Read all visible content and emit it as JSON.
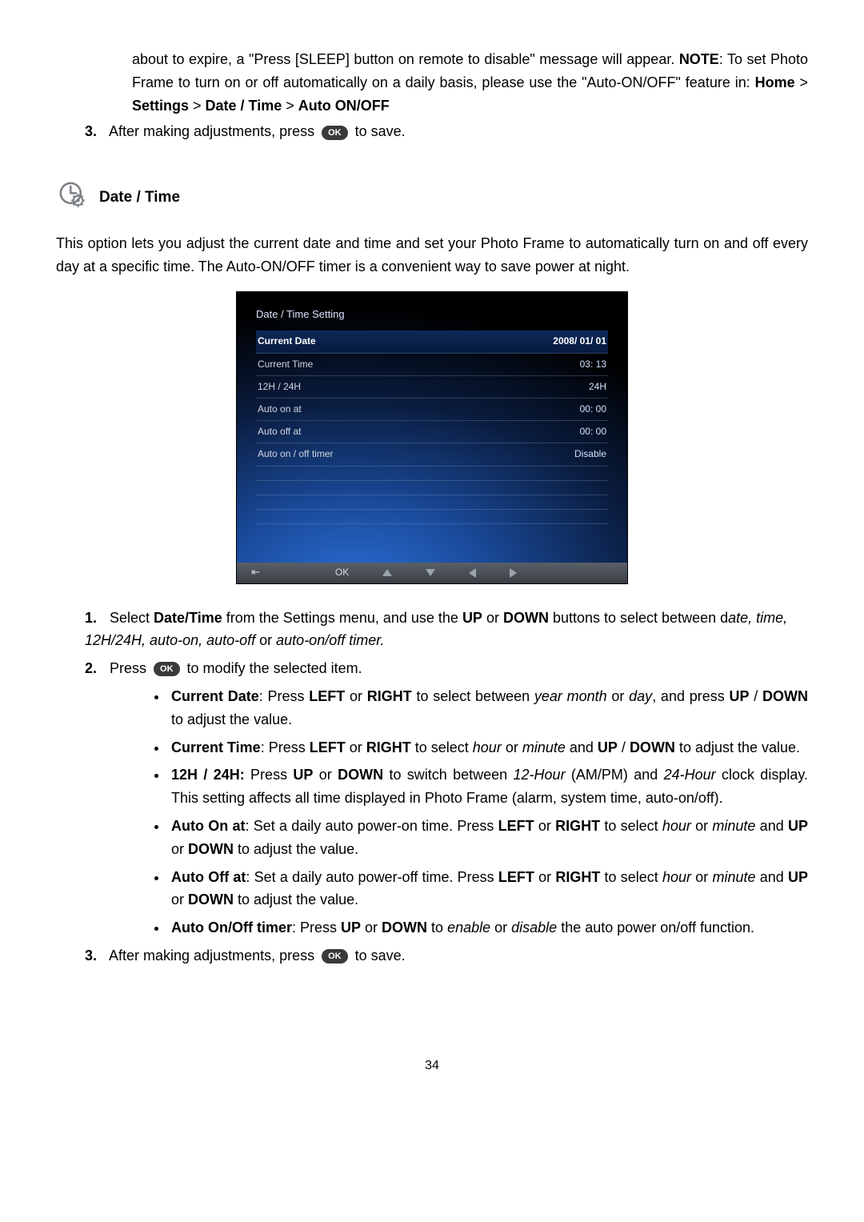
{
  "intro": {
    "line1_a": "about to expire, a \"Press [SLEEP] button on remote to disable\" message will appear. ",
    "note_word": "NOTE",
    "line1_b": ": To set Photo Frame to turn on or off automatically on a daily basis, please use the \"Auto-ON/OFF\" feature in: ",
    "path_home": "Home",
    "path_sep": " > ",
    "path_settings": "Settings",
    "path_datetime": "Date / Time",
    "path_auto": "Auto ON/OFF"
  },
  "step3_top": {
    "num": "3.",
    "pre": "After making adjustments, press ",
    "ok": "OK",
    "post": " to save."
  },
  "section": {
    "title": "Date / Time",
    "desc": "This option lets you adjust the current date and time and set your Photo Frame to automatically turn on and off every day at a specific time. The Auto-ON/OFF timer is a convenient way to save power at night."
  },
  "screenshot": {
    "title": "Date / Time Setting",
    "rows": [
      {
        "label": "Current Date",
        "value": "2008/ 01/ 01",
        "selected": true
      },
      {
        "label": "Current Time",
        "value": "03: 13"
      },
      {
        "label": "12H / 24H",
        "value": "24H"
      },
      {
        "label": "Auto on at",
        "value": "00: 00"
      },
      {
        "label": "Auto off at",
        "value": "00: 00"
      },
      {
        "label": "Auto on / off timer",
        "value": "Disable"
      }
    ],
    "bar_ok": "OK"
  },
  "steps": {
    "s1": {
      "num": "1.",
      "a": "Select ",
      "b": "Date/Time",
      "c": " from the Settings menu, and use the ",
      "d": "UP",
      "e": " or ",
      "f": "DOWN",
      "g": " buttons to select between d",
      "h": "ate, time, 12H/24H, auto-on, auto-off",
      "i": " or ",
      "j": "auto-on/off timer.",
      "k": ""
    },
    "s2": {
      "num": "2.",
      "pre": "Press ",
      "ok": "OK",
      "post": " to modify the selected item."
    },
    "bullets": {
      "b1": {
        "t": "Current Date",
        "rest_a": ": Press ",
        "k1": "LEFT",
        "rest_b": " or ",
        "k2": "RIGHT",
        "rest_c": " to select between ",
        "i1": "year month",
        "rest_d": " or ",
        "i2": "day",
        "rest_e": ", and press ",
        "k3": "UP",
        "rest_f": " / ",
        "k4": "DOWN",
        "rest_g": " to adjust the value."
      },
      "b2": {
        "t": "Current Time",
        "rest_a": ": Press ",
        "k1": "LEFT",
        "rest_b": " or ",
        "k2": "RIGHT",
        "rest_c": " to select ",
        "i1": "hour",
        "rest_d": " or ",
        "i2": "minute",
        "rest_e": " and ",
        "k3": "UP",
        "rest_f": " / ",
        "k4": "DOWN",
        "rest_g": " to adjust the value."
      },
      "b3": {
        "t": "12H / 24H:",
        "rest_a": " Press ",
        "k1": "UP",
        "rest_b": " or ",
        "k2": "DOWN",
        "rest_c": " to switch between ",
        "i1": "12-Hour",
        "rest_d": " (AM/PM) and ",
        "i2": "24-Hour",
        "rest_e": " clock display. This setting affects all time displayed in Photo Frame (alarm, system time, auto-on/off)."
      },
      "b4": {
        "t": "Auto On at",
        "rest_a": ": Set a daily auto power-on time. Press ",
        "k1": "LEFT",
        "rest_b": " or ",
        "k2": "RIGHT",
        "rest_c": " to select ",
        "i1": "hour",
        "rest_d": " or ",
        "i2": "minute",
        "rest_e": " and ",
        "k3": "UP",
        "rest_f": " or ",
        "k4": "DOWN",
        "rest_g": " to adjust the value."
      },
      "b5": {
        "t": "Auto Off at",
        "rest_a": ": Set a daily auto power-off time. Press ",
        "k1": "LEFT",
        "rest_b": " or ",
        "k2": "RIGHT",
        "rest_c": " to select ",
        "i1": "hour",
        "rest_d": " or ",
        "i2": "minute",
        "rest_e": " and ",
        "k3": "UP",
        "rest_f": " or ",
        "k4": "DOWN",
        "rest_g": " to adjust the value."
      },
      "b6": {
        "t": "Auto On/Off timer",
        "rest_a": ": Press ",
        "k1": "UP",
        "rest_b": " or ",
        "k2": "DOWN",
        "rest_c": " to ",
        "i1": "enable",
        "rest_d": " or ",
        "i2": "disable",
        "rest_e": " the auto power on/off function."
      }
    },
    "s3": {
      "num": "3.",
      "pre": "After making adjustments, press ",
      "ok": "OK",
      "post": " to save."
    }
  },
  "page_number": "34"
}
